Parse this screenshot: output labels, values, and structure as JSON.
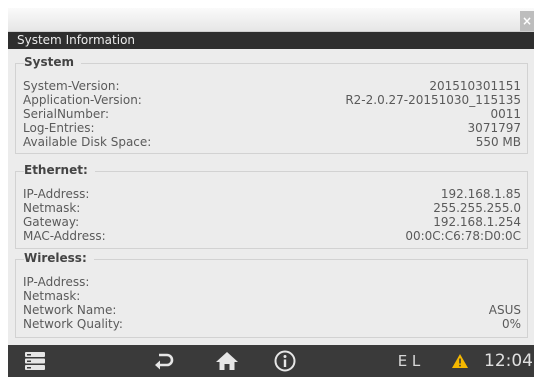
{
  "window": {
    "close_label": "×",
    "title": "System Information"
  },
  "sections": {
    "system": {
      "title": "System",
      "rows": [
        {
          "label": "System-Version:",
          "value": "201510301151"
        },
        {
          "label": "Application-Version:",
          "value": "R2-2.0.27-20151030_115135"
        },
        {
          "label": "SerialNumber:",
          "value": "0011"
        },
        {
          "label": "Log-Entries:",
          "value": "3071797"
        },
        {
          "label": "Available Disk Space:",
          "value": "550 MB"
        }
      ]
    },
    "ethernet": {
      "title": "Ethernet:",
      "rows": [
        {
          "label": "IP-Address:",
          "value": "192.168.1.85"
        },
        {
          "label": "Netmask:",
          "value": "255.255.255.0"
        },
        {
          "label": "Gateway:",
          "value": "192.168.1.254"
        },
        {
          "label": "MAC-Address:",
          "value": "00:0C:C6:78:D0:0C"
        }
      ]
    },
    "wireless": {
      "title": "Wireless:",
      "rows": [
        {
          "label": "IP-Address:",
          "value": ""
        },
        {
          "label": "Netmask:",
          "value": ""
        },
        {
          "label": "Network Name:",
          "value": "ASUS"
        },
        {
          "label": "Network Quality:",
          "value": "0%"
        }
      ]
    }
  },
  "bottom_bar": {
    "icons": [
      "menu-icon",
      "back-icon",
      "home-icon",
      "info-icon",
      "warning-icon"
    ],
    "status_letters": "E L",
    "clock": "12:04",
    "warning_color": "#f5b800"
  }
}
